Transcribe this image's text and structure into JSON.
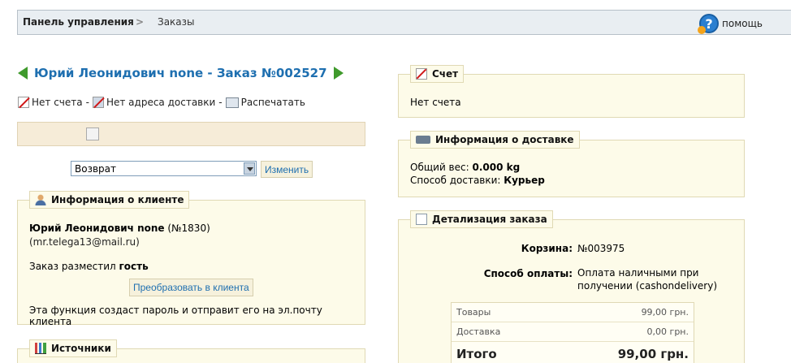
{
  "breadcrumb": {
    "home": "Панель управления",
    "separator": ">",
    "current": "Заказы"
  },
  "help": {
    "label": "помощь",
    "icon": "help-icon"
  },
  "order": {
    "title": "Юрий Леонидович none - Заказ №002527",
    "actions": {
      "no_invoice": "Нет счета",
      "no_address": "Нет адреса доставки",
      "print": "Распечатать",
      "separator": "-"
    }
  },
  "status": {
    "selected": "Возврат",
    "change_button": "Изменить"
  },
  "client": {
    "panel_title": "Информация о клиенте",
    "name": "Юрий Леонидович none",
    "id": "(№1830)",
    "email": "(mr.telega13@mail.ru)",
    "placed_prefix": "Заказ разместил",
    "placed_by": "гость",
    "convert_button": "Преобразовать в клиента",
    "note": "Эта функция создаст пароль и отправит его на эл.почту клиента"
  },
  "sources": {
    "panel_title": "Источники"
  },
  "invoice": {
    "panel_title": "Счет",
    "text": "Нет счета"
  },
  "delivery": {
    "panel_title": "Информация о доставке",
    "weight_label": "Общий вес:",
    "weight_value": "0.000 kg",
    "method_label": "Способ доставки:",
    "method_value": "Курьер"
  },
  "details": {
    "panel_title": "Детализация заказа",
    "cart_label": "Корзина:",
    "cart_value": "№003975",
    "payment_label": "Способ оплаты:",
    "payment_line1": "Оплата наличными при",
    "payment_line2": "получении (cashondelivery)",
    "goods_label": "Товары",
    "goods_value": "99,00 грн.",
    "shipping_label": "Доставка",
    "shipping_value": "0,00 грн.",
    "total_label": "Итого",
    "total_value": "99,00 грн."
  }
}
